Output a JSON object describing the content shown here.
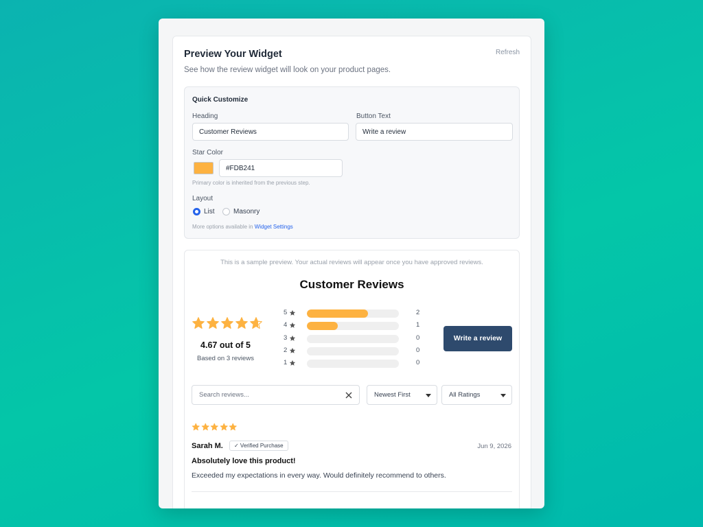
{
  "page": {
    "title": "Preview Your Widget",
    "refresh": "Refresh",
    "subtitle": "See how the review widget will look on your product pages."
  },
  "quick_customize": {
    "title": "Quick Customize",
    "heading_label": "Heading",
    "heading_value": "Customer Reviews",
    "button_text_label": "Button Text",
    "button_text_value": "Write a review",
    "star_color_label": "Star Color",
    "star_color_value": "#FDB241",
    "star_color_hint": "Primary color is inherited from the previous step.",
    "layout_label": "Layout",
    "layout_options": [
      {
        "label": "List",
        "selected": true
      },
      {
        "label": "Masonry",
        "selected": false
      }
    ],
    "more_options_prefix": "More options available in",
    "more_options_link": "Widget Settings"
  },
  "preview": {
    "note": "This is a sample preview. Your actual reviews will appear once you have approved reviews.",
    "heading": "Customer Reviews",
    "average_rating": 4.67,
    "average_text": "4.67 out of 5",
    "based_on": "Based on 3 reviews",
    "star_color": "#FDB241",
    "distribution": [
      {
        "stars": "5",
        "count": "2",
        "fraction": 0.667
      },
      {
        "stars": "4",
        "count": "1",
        "fraction": 0.333
      },
      {
        "stars": "3",
        "count": "0",
        "fraction": 0
      },
      {
        "stars": "2",
        "count": "0",
        "fraction": 0
      },
      {
        "stars": "1",
        "count": "0",
        "fraction": 0
      }
    ],
    "write_button": "Write a review",
    "search_placeholder": "Search reviews...",
    "sort_selected": "Newest First",
    "filter_selected": "All Ratings",
    "review": {
      "rating": 5,
      "author": "Sarah M.",
      "badge": "✓ Verified Purchase",
      "date": "Jun 9, 2026",
      "title": "Absolutely love this product!",
      "body": "Exceeded my expectations in every way. Would definitely recommend to others."
    }
  },
  "icons": {
    "star": "star-icon",
    "clear": "close-icon",
    "caret": "chevron-down-icon"
  }
}
